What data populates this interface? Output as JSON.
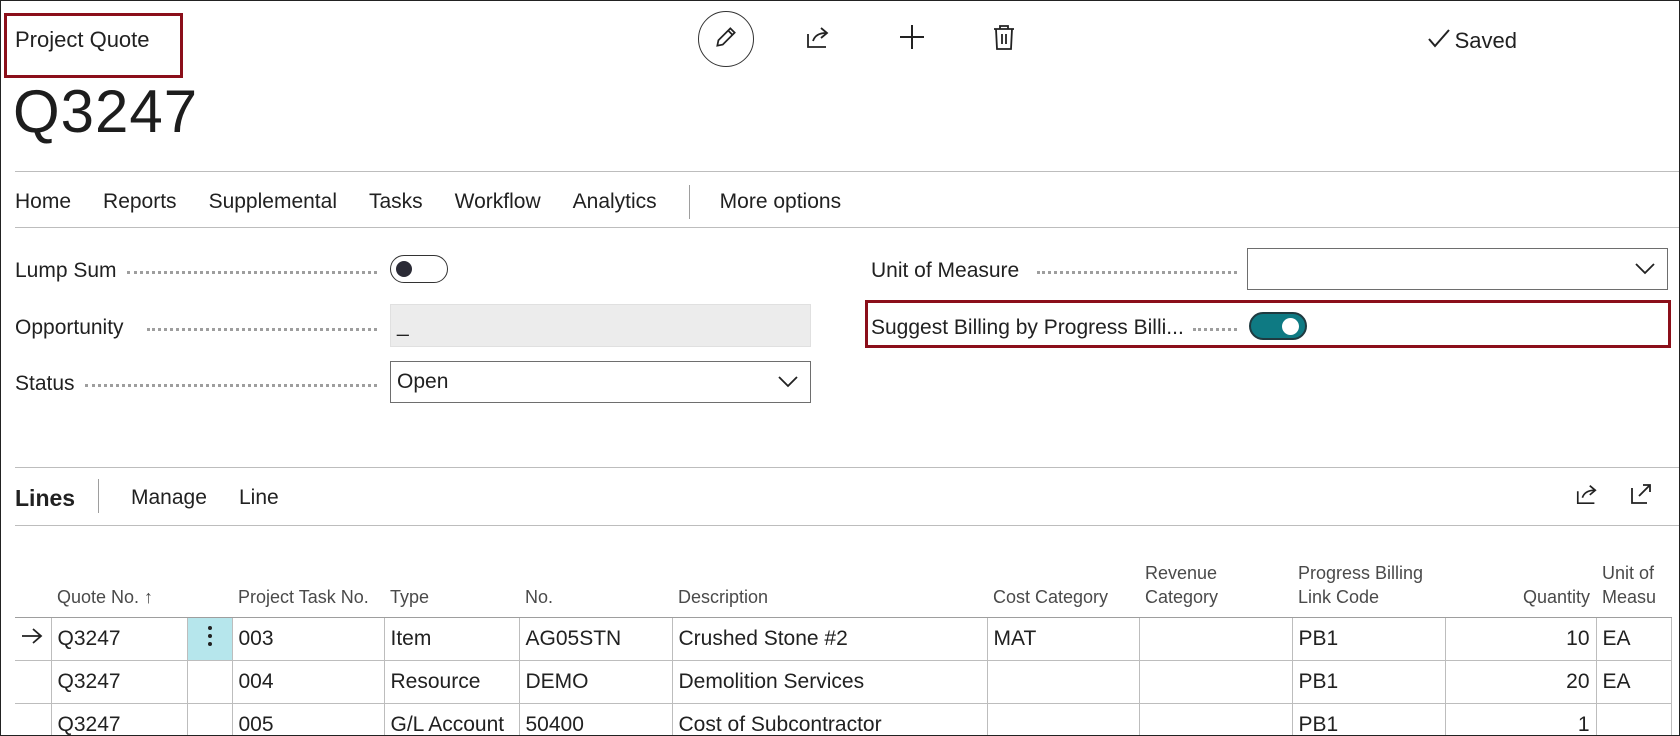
{
  "header": {
    "caption": "Project Quote",
    "record_no": "Q3247",
    "status_text": "Saved"
  },
  "toolbar": {
    "icons": [
      "edit-icon",
      "share-icon",
      "add-icon",
      "delete-icon"
    ]
  },
  "actions": [
    "Home",
    "Reports",
    "Supplemental",
    "Tasks",
    "Workflow",
    "Analytics",
    "More options"
  ],
  "fields": {
    "lump_sum": {
      "label": "Lump Sum",
      "value": false
    },
    "opportunity": {
      "label": "Opportunity",
      "value": "_"
    },
    "status": {
      "label": "Status",
      "value": "Open"
    },
    "unit_of_measure": {
      "label": "Unit of Measure",
      "value": ""
    },
    "suggest_billing": {
      "label": "Suggest Billing by Progress Billi...",
      "value": true
    }
  },
  "lines": {
    "title": "Lines",
    "actions": [
      "Manage",
      "Line"
    ],
    "columns": {
      "quote_no": "Quote No. ↑",
      "project_task_no": "Project Task No.",
      "type": "Type",
      "no": "No.",
      "description": "Description",
      "cost_category": "Cost Category",
      "revenue_category": "Revenue Category",
      "pb_link": "Progress Billing Link Code",
      "quantity": "Quantity",
      "uom": "Unit of Measu"
    },
    "rows": [
      {
        "quote_no": "Q3247",
        "task": "003",
        "type": "Item",
        "no": "AG05STN",
        "description": "Crushed Stone #2",
        "cost_category": "MAT",
        "revenue_category": "",
        "pb_link": "PB1",
        "quantity": "10",
        "uom": "EA"
      },
      {
        "quote_no": "Q3247",
        "task": "004",
        "type": "Resource",
        "no": "DEMO",
        "description": "Demolition Services",
        "cost_category": "",
        "revenue_category": "",
        "pb_link": "PB1",
        "quantity": "20",
        "uom": "EA"
      },
      {
        "quote_no": "Q3247",
        "task": "005",
        "type": "G/L Account",
        "no": "50400",
        "description": "Cost of Subcontractor",
        "cost_category": "",
        "revenue_category": "",
        "pb_link": "PB1",
        "quantity": "1",
        "uom": ""
      }
    ]
  },
  "colors": {
    "accent_toggle": "#0e7a83",
    "highlight_box": "#8b0f1a",
    "selected_cell": "#b6e6ec"
  }
}
